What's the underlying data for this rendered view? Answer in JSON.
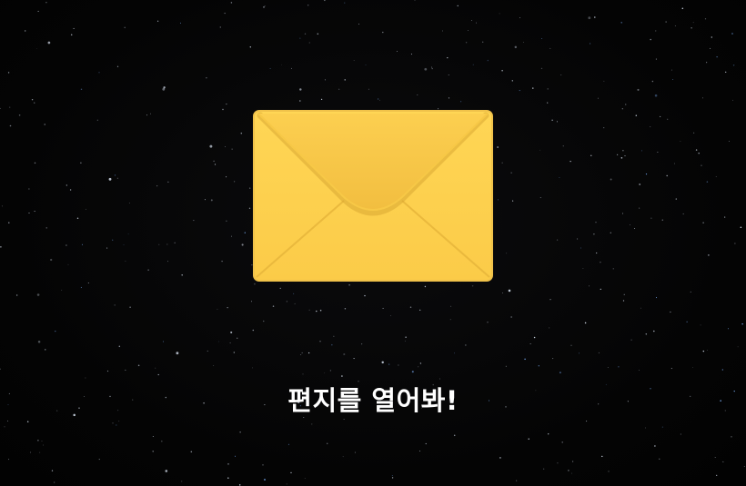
{
  "scene": {
    "background_color": "#050505",
    "star_color": "#cfd8e6",
    "star_accent_color": "#7fb4ff"
  },
  "envelope": {
    "icon": "envelope-icon",
    "color": "#fdd04f",
    "shade_color": "#e7b53a",
    "border_color": "#f0c24a"
  },
  "caption": {
    "text": "편지를 열어봐!",
    "color": "#ffffff"
  }
}
